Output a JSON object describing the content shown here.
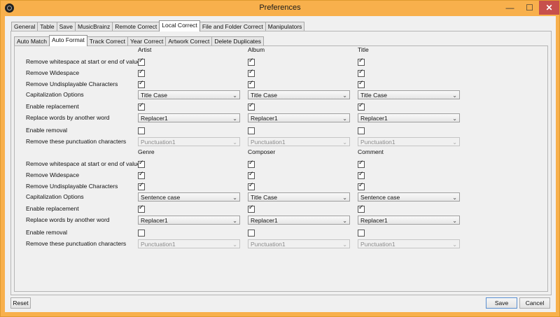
{
  "window": {
    "title": "Preferences"
  },
  "titlebar": {
    "minimize": "—",
    "maximize": "☐",
    "close": "✕"
  },
  "tabs": [
    "General",
    "Table",
    "Save",
    "MusicBrainz",
    "Remote Correct",
    "Local Correct",
    "File and Folder Correct",
    "Manipulators"
  ],
  "active_tab": "Local Correct",
  "subtabs": [
    "Auto Match",
    "Auto Format",
    "Track Correct",
    "Year Correct",
    "Artwork Correct",
    "Delete Duplicates"
  ],
  "active_subtab": "Auto Format",
  "row_labels": [
    "Remove whitespace at start or end of value",
    "Remove Widespace",
    "Remove Undisplayable Characters",
    "Capitalization Options",
    "Enable replacement",
    "Replace words by another word",
    "Enable removal",
    "Remove these punctuation characters"
  ],
  "groups": [
    {
      "columns": [
        {
          "header": "Artist",
          "remove_ws": true,
          "remove_widespace": true,
          "remove_undisplayable": true,
          "capitalization": "Title Case",
          "enable_replacement": true,
          "replacer": "Replacer1",
          "enable_removal": false,
          "punctuation": "Punctuation1"
        },
        {
          "header": "Album",
          "remove_ws": true,
          "remove_widespace": true,
          "remove_undisplayable": true,
          "capitalization": "Title Case",
          "enable_replacement": true,
          "replacer": "Replacer1",
          "enable_removal": false,
          "punctuation": "Punctuation1"
        },
        {
          "header": "Title",
          "remove_ws": true,
          "remove_widespace": true,
          "remove_undisplayable": true,
          "capitalization": "Title Case",
          "enable_replacement": true,
          "replacer": "Replacer1",
          "enable_removal": false,
          "punctuation": "Punctuation1"
        }
      ]
    },
    {
      "columns": [
        {
          "header": "Genre",
          "remove_ws": true,
          "remove_widespace": true,
          "remove_undisplayable": true,
          "capitalization": "Sentence case",
          "enable_replacement": true,
          "replacer": "Replacer1",
          "enable_removal": false,
          "punctuation": "Punctuation1"
        },
        {
          "header": "Composer",
          "remove_ws": true,
          "remove_widespace": true,
          "remove_undisplayable": true,
          "capitalization": "Title Case",
          "enable_replacement": true,
          "replacer": "Replacer1",
          "enable_removal": false,
          "punctuation": "Punctuation1"
        },
        {
          "header": "Comment",
          "remove_ws": true,
          "remove_widespace": true,
          "remove_undisplayable": true,
          "capitalization": "Sentence case",
          "enable_replacement": true,
          "replacer": "Replacer1",
          "enable_removal": false,
          "punctuation": "Punctuation1"
        }
      ]
    }
  ],
  "buttons": {
    "reset": "Reset",
    "save": "Save",
    "cancel": "Cancel"
  },
  "colors": {
    "titlebar": "#f8b04c",
    "close": "#c7504c",
    "panel": "#f0f0f0"
  }
}
